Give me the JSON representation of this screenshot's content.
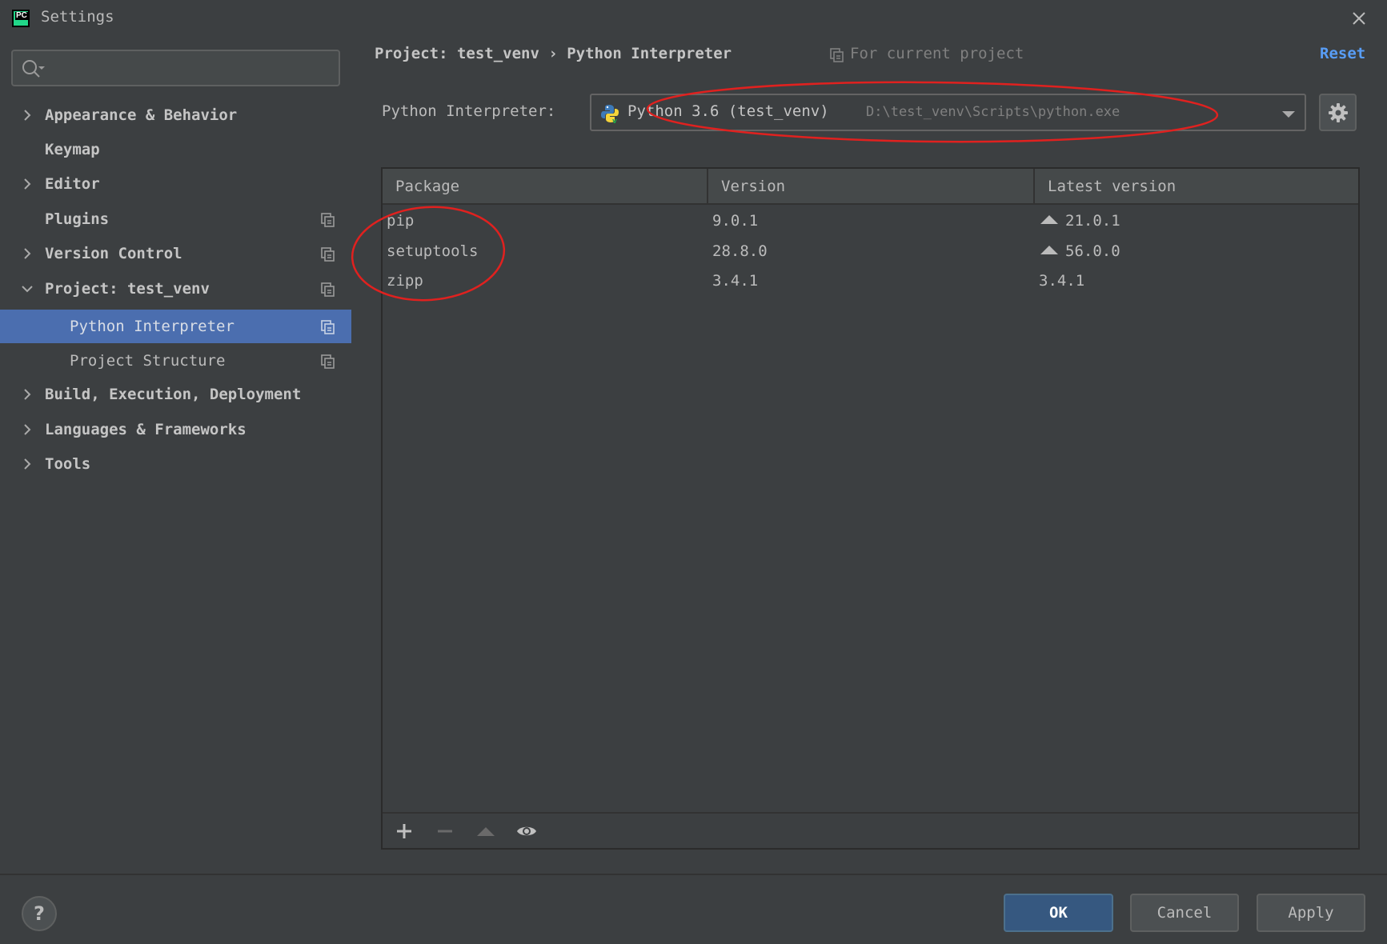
{
  "window": {
    "title": "Settings",
    "logo_text": "PC"
  },
  "sidebar": {
    "search_placeholder": "",
    "items": [
      {
        "label": "Appearance & Behavior",
        "expandable": true,
        "expanded": false
      },
      {
        "label": "Keymap",
        "expandable": false
      },
      {
        "label": "Editor",
        "expandable": true,
        "expanded": false
      },
      {
        "label": "Plugins",
        "expandable": false,
        "project_icon": true
      },
      {
        "label": "Version Control",
        "expandable": true,
        "expanded": false,
        "project_icon": true
      },
      {
        "label": "Project: test_venv",
        "expandable": true,
        "expanded": true,
        "project_icon": true
      },
      {
        "label": "Python Interpreter",
        "child": true,
        "selected": true,
        "project_icon": true
      },
      {
        "label": "Project Structure",
        "child": true,
        "project_icon": true
      },
      {
        "label": "Build, Execution, Deployment",
        "expandable": true,
        "expanded": false
      },
      {
        "label": "Languages & Frameworks",
        "expandable": true,
        "expanded": false
      },
      {
        "label": "Tools",
        "expandable": true,
        "expanded": false
      }
    ]
  },
  "header": {
    "breadcrumb": "Project: test_venv › Python Interpreter",
    "scope_label": "For current project",
    "reset_label": "Reset"
  },
  "interpreter": {
    "label": "Python Interpreter:",
    "name": "Python 3.6 (test_venv)",
    "path": "D:\\test_venv\\Scripts\\python.exe"
  },
  "packages": {
    "columns": [
      "Package",
      "Version",
      "Latest version"
    ],
    "rows": [
      {
        "name": "pip",
        "version": "9.0.1",
        "latest": "21.0.1",
        "upgrade": true
      },
      {
        "name": "setuptools",
        "version": "28.8.0",
        "latest": "56.0.0",
        "upgrade": true
      },
      {
        "name": "zipp",
        "version": "3.4.1",
        "latest": "3.4.1",
        "upgrade": false
      }
    ]
  },
  "footer": {
    "help_label": "?",
    "ok_label": "OK",
    "cancel_label": "Cancel",
    "apply_label": "Apply"
  },
  "colors": {
    "background": "#3c3f41",
    "selection": "#4b6eaf",
    "link": "#589df6",
    "annotation": "#e0211f",
    "ok_button": "#365880"
  }
}
